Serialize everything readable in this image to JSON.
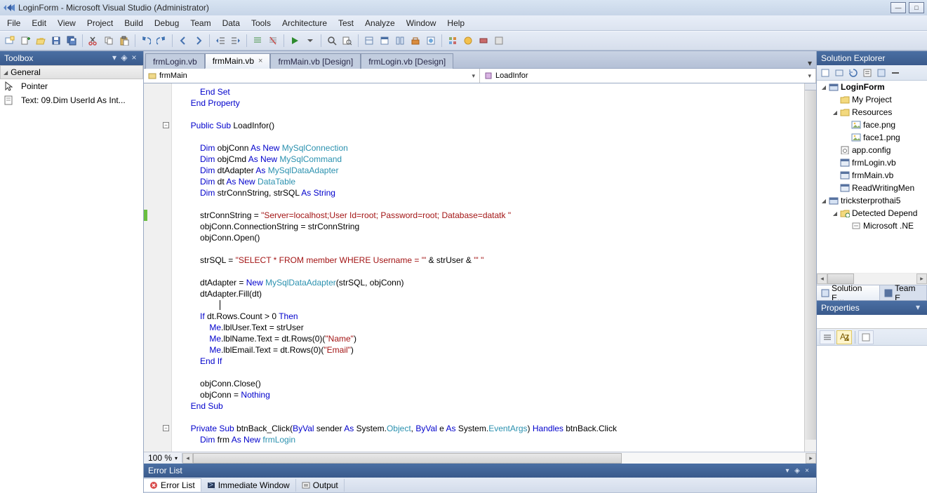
{
  "window": {
    "title": "LoginForm - Microsoft Visual Studio (Administrator)"
  },
  "menu": {
    "items": [
      "File",
      "Edit",
      "View",
      "Project",
      "Build",
      "Debug",
      "Team",
      "Data",
      "Tools",
      "Architecture",
      "Test",
      "Analyze",
      "Window",
      "Help"
    ]
  },
  "toolbox": {
    "title": "Toolbox",
    "group": "General",
    "items": [
      {
        "icon": "pointer-icon",
        "label": "Pointer"
      },
      {
        "icon": "text-file-icon",
        "label": "Text: 09.Dim UserId As Int..."
      }
    ]
  },
  "doc_tabs": {
    "tabs": [
      {
        "label": "frmLogin.vb",
        "active": false
      },
      {
        "label": "frmMain.vb",
        "active": true,
        "closable": true
      },
      {
        "label": "frmMain.vb [Design]",
        "active": false
      },
      {
        "label": "frmLogin.vb [Design]",
        "active": false
      }
    ]
  },
  "nav_dropdowns": {
    "left": {
      "text": "frmMain",
      "icon": "class-icon"
    },
    "right": {
      "text": "LoadInfor",
      "icon": "method-icon"
    }
  },
  "editor": {
    "zoom": "100 %",
    "code": {
      "lines": [
        {
          "indent": 12,
          "tokens": [
            [
              "kw",
              "End Set"
            ]
          ]
        },
        {
          "indent": 8,
          "tokens": [
            [
              "kw",
              "End Property"
            ]
          ]
        },
        {
          "blank": true
        },
        {
          "indent": 8,
          "fold": true,
          "tokens": [
            [
              "kw",
              "Public Sub"
            ],
            [
              "plain",
              " LoadInfor()"
            ]
          ]
        },
        {
          "blank": true
        },
        {
          "indent": 12,
          "tokens": [
            [
              "kw",
              "Dim"
            ],
            [
              "plain",
              " objConn "
            ],
            [
              "kw",
              "As New "
            ],
            [
              "type",
              "MySqlConnection"
            ]
          ]
        },
        {
          "indent": 12,
          "tokens": [
            [
              "kw",
              "Dim"
            ],
            [
              "plain",
              " objCmd "
            ],
            [
              "kw",
              "As New "
            ],
            [
              "type",
              "MySqlCommand"
            ]
          ]
        },
        {
          "indent": 12,
          "tokens": [
            [
              "kw",
              "Dim"
            ],
            [
              "plain",
              " dtAdapter "
            ],
            [
              "kw",
              "As "
            ],
            [
              "type",
              "MySqlDataAdapter"
            ]
          ]
        },
        {
          "indent": 12,
          "tokens": [
            [
              "kw",
              "Dim"
            ],
            [
              "plain",
              " dt "
            ],
            [
              "kw",
              "As New "
            ],
            [
              "type",
              "DataTable"
            ]
          ]
        },
        {
          "indent": 12,
          "tokens": [
            [
              "kw",
              "Dim"
            ],
            [
              "plain",
              " strConnString, strSQL "
            ],
            [
              "kw",
              "As String"
            ]
          ]
        },
        {
          "blank": true
        },
        {
          "indent": 12,
          "change": true,
          "tokens": [
            [
              "plain",
              "strConnString = "
            ],
            [
              "str",
              "\"Server=localhost;User Id=root; Password=root; Database=datatk \""
            ]
          ]
        },
        {
          "indent": 12,
          "tokens": [
            [
              "plain",
              "objConn.ConnectionString = strConnString"
            ]
          ]
        },
        {
          "indent": 12,
          "tokens": [
            [
              "plain",
              "objConn.Open()"
            ]
          ]
        },
        {
          "blank": true
        },
        {
          "indent": 12,
          "tokens": [
            [
              "plain",
              "strSQL = "
            ],
            [
              "str",
              "\"SELECT * FROM member WHERE Username = '\""
            ],
            [
              "plain",
              " & strUser & "
            ],
            [
              "str",
              "\"' \""
            ]
          ]
        },
        {
          "blank": true
        },
        {
          "indent": 12,
          "tokens": [
            [
              "plain",
              "dtAdapter = "
            ],
            [
              "kw",
              "New "
            ],
            [
              "type",
              "MySqlDataAdapter"
            ],
            [
              "plain",
              "(strSQL, objConn)"
            ]
          ]
        },
        {
          "indent": 12,
          "tokens": [
            [
              "plain",
              "dtAdapter.Fill(dt)"
            ]
          ]
        },
        {
          "indent": 12,
          "caret": true,
          "tokens": [
            [
              "plain",
              ""
            ]
          ]
        },
        {
          "indent": 12,
          "tokens": [
            [
              "kw",
              "If"
            ],
            [
              "plain",
              " dt.Rows.Count > 0 "
            ],
            [
              "kw",
              "Then"
            ]
          ]
        },
        {
          "indent": 16,
          "tokens": [
            [
              "kw",
              "Me"
            ],
            [
              "plain",
              ".lblUser.Text = strUser"
            ]
          ]
        },
        {
          "indent": 16,
          "tokens": [
            [
              "kw",
              "Me"
            ],
            [
              "plain",
              ".lblName.Text = dt.Rows(0)("
            ],
            [
              "str",
              "\"Name\""
            ],
            [
              "plain",
              ")"
            ]
          ]
        },
        {
          "indent": 16,
          "tokens": [
            [
              "kw",
              "Me"
            ],
            [
              "plain",
              ".lblEmail.Text = dt.Rows(0)("
            ],
            [
              "str",
              "\"Email\""
            ],
            [
              "plain",
              ")"
            ]
          ]
        },
        {
          "indent": 12,
          "tokens": [
            [
              "kw",
              "End If"
            ]
          ]
        },
        {
          "blank": true
        },
        {
          "indent": 12,
          "tokens": [
            [
              "plain",
              "objConn.Close()"
            ]
          ]
        },
        {
          "indent": 12,
          "tokens": [
            [
              "plain",
              "objConn = "
            ],
            [
              "kw",
              "Nothing"
            ]
          ]
        },
        {
          "indent": 8,
          "tokens": [
            [
              "kw",
              "End Sub"
            ]
          ]
        },
        {
          "blank": true
        },
        {
          "indent": 8,
          "fold": true,
          "tokens": [
            [
              "kw",
              "Private Sub"
            ],
            [
              "plain",
              " btnBack_Click("
            ],
            [
              "kw",
              "ByVal"
            ],
            [
              "plain",
              " sender "
            ],
            [
              "kw",
              "As"
            ],
            [
              "plain",
              " System."
            ],
            [
              "type",
              "Object"
            ],
            [
              "plain",
              ", "
            ],
            [
              "kw",
              "ByVal"
            ],
            [
              "plain",
              " e "
            ],
            [
              "kw",
              "As"
            ],
            [
              "plain",
              " System."
            ],
            [
              "type",
              "EventArgs"
            ],
            [
              "plain",
              ") "
            ],
            [
              "kw",
              "Handles"
            ],
            [
              "plain",
              " btnBack.Click"
            ]
          ]
        },
        {
          "indent": 12,
          "tokens": [
            [
              "kw",
              "Dim"
            ],
            [
              "plain",
              " frm "
            ],
            [
              "kw",
              "As New "
            ],
            [
              "type",
              "frmLogin"
            ]
          ]
        }
      ]
    }
  },
  "solution_explorer": {
    "title": "Solution Explorer",
    "tree": [
      {
        "depth": 0,
        "exp": "▾",
        "icon": "project-icon",
        "label": "LoginForm",
        "bold": true
      },
      {
        "depth": 1,
        "exp": "",
        "icon": "folder-icon",
        "label": "My Project"
      },
      {
        "depth": 1,
        "exp": "▾",
        "icon": "folder-icon",
        "label": "Resources"
      },
      {
        "depth": 2,
        "exp": "",
        "icon": "image-icon",
        "label": "face.png"
      },
      {
        "depth": 2,
        "exp": "",
        "icon": "image-icon",
        "label": "face1.png"
      },
      {
        "depth": 1,
        "exp": "",
        "icon": "config-icon",
        "label": "app.config"
      },
      {
        "depth": 1,
        "exp": "",
        "icon": "form-icon",
        "label": "frmLogin.vb"
      },
      {
        "depth": 1,
        "exp": "",
        "icon": "form-icon",
        "label": "frmMain.vb"
      },
      {
        "depth": 1,
        "exp": "",
        "icon": "form-icon",
        "label": "ReadWritingMen"
      },
      {
        "depth": 0,
        "exp": "▾",
        "icon": "project-icon",
        "label": "tricksterprothai5"
      },
      {
        "depth": 1,
        "exp": "▾",
        "icon": "folder-ref-icon",
        "label": "Detected Depend"
      },
      {
        "depth": 2,
        "exp": "",
        "icon": "ref-icon",
        "label": "Microsoft .NE"
      }
    ],
    "tabs": [
      {
        "label": "Solution E...",
        "icon": "solution-icon",
        "active": true
      },
      {
        "label": "Team E",
        "icon": "team-icon",
        "active": false
      }
    ]
  },
  "properties": {
    "title": "Properties"
  },
  "error_list": {
    "title": "Error List",
    "tabs": [
      {
        "label": "Error List",
        "icon": "error-icon",
        "active": true
      },
      {
        "label": "Immediate Window",
        "icon": "immediate-icon",
        "active": false
      },
      {
        "label": "Output",
        "icon": "output-icon",
        "active": false
      }
    ]
  }
}
